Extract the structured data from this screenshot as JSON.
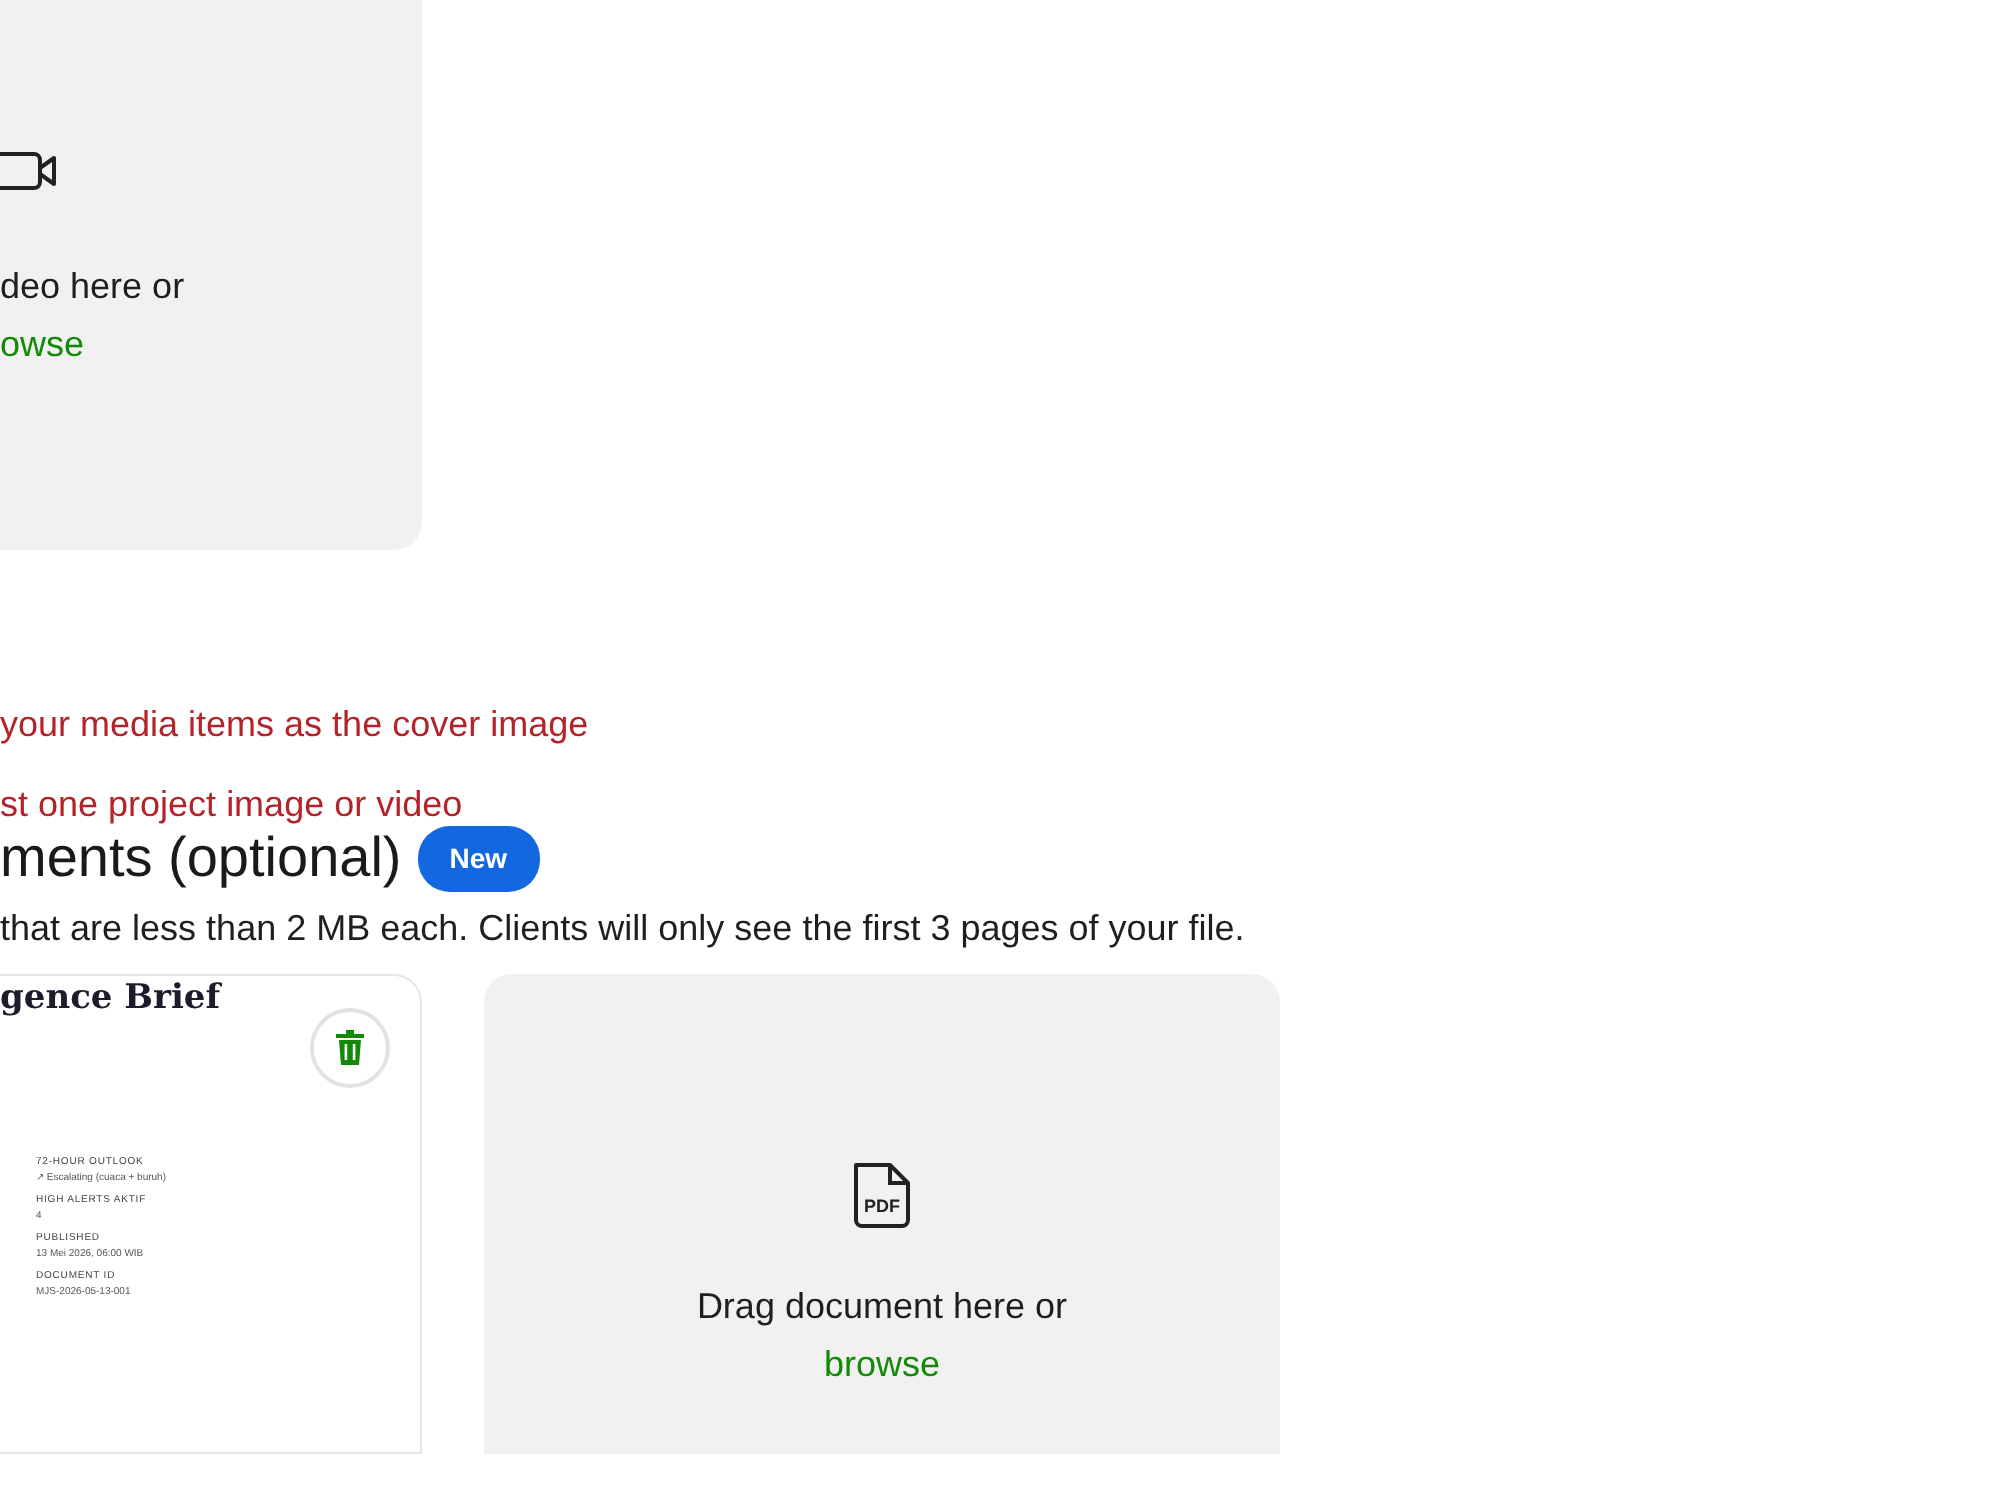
{
  "video_upload": {
    "prompt": "deo here or",
    "browse": "owse"
  },
  "errors": [
    "your media items as the cover image",
    "st one project image or video"
  ],
  "documents_section": {
    "heading": "ments (optional)",
    "badge": "New",
    "description": "that are less than 2 MB each. Clients will only see the first 3 pages of your file."
  },
  "uploaded_document": {
    "title": "gence Brief",
    "fields": [
      {
        "label": "72-HOUR OUTLOOK",
        "value": "↗ Escalating (cuaca + buruh)"
      },
      {
        "label": "HIGH ALERTS AKTIF",
        "value": "4"
      },
      {
        "label": "PUBLISHED",
        "value": "13 Mei 2026, 06:00 WIB"
      },
      {
        "label": "DOCUMENT ID",
        "value": "MJS-2026-05-13-001"
      }
    ]
  },
  "document_upload": {
    "icon_label": "PDF",
    "prompt": "Drag document here or",
    "browse": "browse"
  }
}
